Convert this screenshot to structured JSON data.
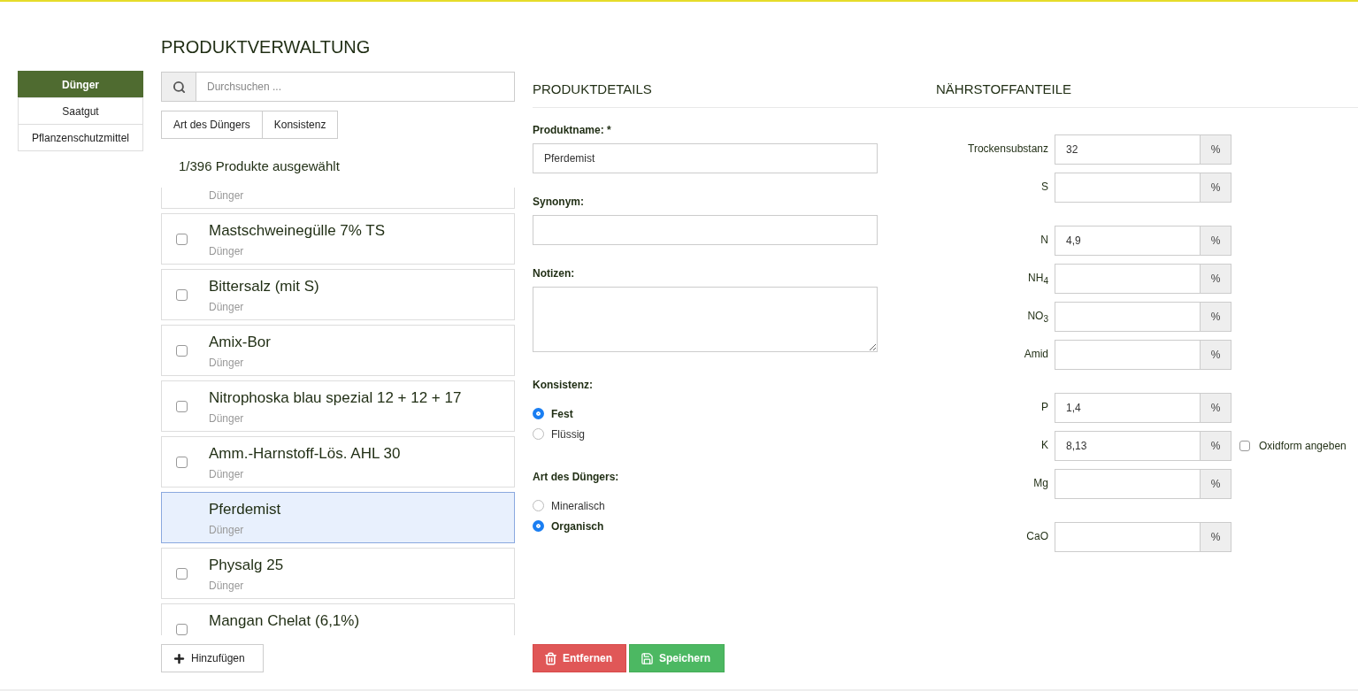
{
  "title": "PRODUKTVERWALTUNG",
  "categories": [
    {
      "label": "Dünger",
      "selected": true
    },
    {
      "label": "Saatgut",
      "selected": false
    },
    {
      "label": "Pflanzenschutzmittel",
      "selected": false
    }
  ],
  "search": {
    "placeholder": "Durchsuchen ..."
  },
  "filters": [
    "Art des Düngers",
    "Konsistenz"
  ],
  "count": "1/396 Produkte ausgewählt",
  "products": [
    {
      "subtitle": "Dünger",
      "selected": false,
      "kind": "cut-top"
    },
    {
      "name": "Mastschweinegülle 7% TS",
      "subtitle": "Dünger",
      "selected": false,
      "checked": false,
      "kind": "full"
    },
    {
      "name": "Bittersalz (mit S)",
      "subtitle": "Dünger",
      "selected": false,
      "checked": false,
      "kind": "full"
    },
    {
      "name": "Amix-Bor",
      "subtitle": "Dünger",
      "selected": false,
      "checked": false,
      "kind": "full"
    },
    {
      "name": "Nitrophoska blau spezial 12 + 12 + 17",
      "subtitle": "Dünger",
      "selected": false,
      "checked": false,
      "kind": "full"
    },
    {
      "name": "Amm.-Harnstoff-Lös. AHL 30",
      "subtitle": "Dünger",
      "selected": false,
      "checked": false,
      "kind": "full"
    },
    {
      "name": "Pferdemist",
      "subtitle": "Dünger",
      "selected": true,
      "kind": "full"
    },
    {
      "name": "Physalg 25",
      "subtitle": "Dünger",
      "selected": false,
      "checked": false,
      "kind": "full"
    },
    {
      "name": "Mangan Chelat (6,1%)",
      "selected": false,
      "checked": false,
      "kind": "cut-bottom"
    }
  ],
  "add_button": "Hinzufügen",
  "details": {
    "heading": "PRODUKTDETAILS",
    "fields": [
      {
        "label": "Produktname: *",
        "value": "Pferdemist",
        "kind": "input"
      },
      {
        "label": "Synonym:",
        "kind": "input"
      },
      {
        "label": "Notizen:",
        "kind": "textarea"
      }
    ],
    "radio_groups": [
      {
        "label": "Konsistenz:",
        "options": [
          {
            "label": "Fest",
            "selected": true
          },
          {
            "label": "Flüssig",
            "selected": false
          }
        ]
      },
      {
        "label": "Art des Düngers:",
        "options": [
          {
            "label": "Mineralisch",
            "selected": false
          },
          {
            "label": "Organisch",
            "selected": true
          }
        ]
      }
    ],
    "buttons": [
      {
        "label": "Entfernen",
        "kind": "danger"
      },
      {
        "label": "Speichern",
        "kind": "success"
      }
    ]
  },
  "nutrients": {
    "heading": "NÄHRSTOFFANTEILE",
    "groups": [
      [
        {
          "label": "Trockensubstanz",
          "value": "32",
          "unit": "%"
        },
        {
          "label": "S",
          "unit": "%"
        }
      ],
      [
        {
          "label": "N",
          "value": "4,9",
          "unit": "%"
        },
        {
          "label": "NH$_{4}$",
          "unit": "%"
        },
        {
          "label": "NO$_{3}$",
          "unit": "%"
        },
        {
          "label": "Amid",
          "unit": "%"
        }
      ],
      [
        {
          "label": "P",
          "value": "1,4",
          "unit": "%"
        },
        {
          "label": "K",
          "value": "8,13",
          "unit": "%",
          "option": {
            "label": "Oxidform angeben",
            "checked": false
          }
        },
        {
          "label": "Mg",
          "unit": "%"
        }
      ],
      [
        {
          "label": "CaO",
          "unit": "%"
        }
      ]
    ]
  }
}
